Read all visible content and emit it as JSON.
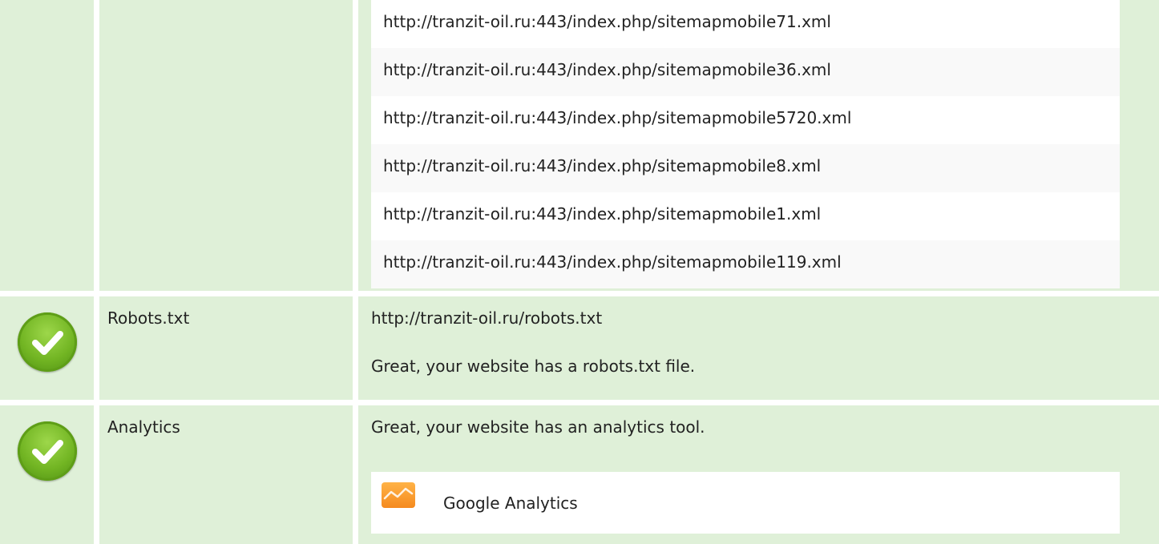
{
  "sitemaps": {
    "urls": [
      "http://tranzit-oil.ru:443/index.php/sitemapmobile71.xml",
      "http://tranzit-oil.ru:443/index.php/sitemapmobile36.xml",
      "http://tranzit-oil.ru:443/index.php/sitemapmobile5720.xml",
      "http://tranzit-oil.ru:443/index.php/sitemapmobile8.xml",
      "http://tranzit-oil.ru:443/index.php/sitemapmobile1.xml",
      "http://tranzit-oil.ru:443/index.php/sitemapmobile119.xml"
    ]
  },
  "robots": {
    "status_icon": "check-icon",
    "label": "Robots.txt",
    "url": "http://tranzit-oil.ru/robots.txt",
    "message": "Great, your website has a robots.txt file."
  },
  "analytics": {
    "status_icon": "check-icon",
    "label": "Analytics",
    "message": "Great, your website has an analytics tool.",
    "tools": [
      {
        "name": "Google Analytics",
        "icon": "google-analytics-icon"
      }
    ]
  },
  "colors": {
    "row_background": "#dff0d8",
    "check_green": "#72b523",
    "analytics_orange": "#f58a1f"
  }
}
